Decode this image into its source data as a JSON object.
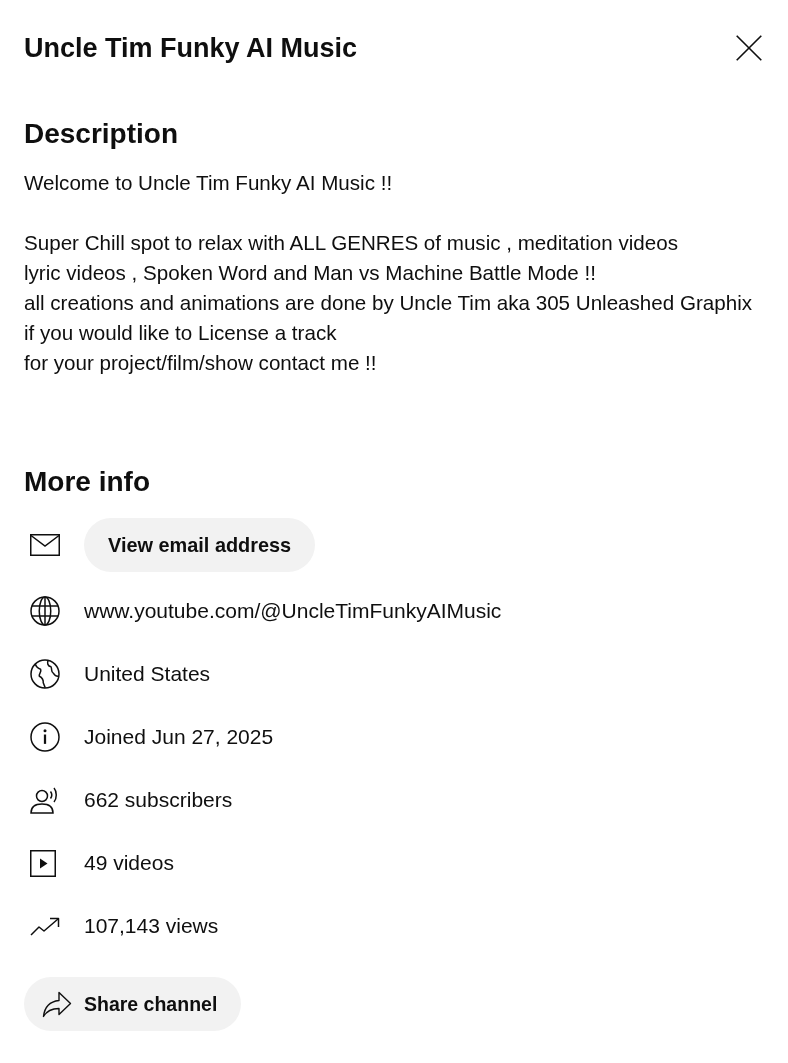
{
  "title": "Uncle Tim Funky AI Music",
  "description": {
    "heading": "Description",
    "text": "Welcome to Uncle Tim Funky AI Music !!\n\nSuper Chill spot to relax with ALL GENRES of music , meditation videos\nlyric videos , Spoken Word and Man vs Machine Battle Mode !!\nall creations and animations are done by Uncle Tim aka 305 Unleashed Graphix\nif you would like to License a track\nfor your project/film/show contact me !!"
  },
  "more_info": {
    "heading": "More info",
    "items": [
      {
        "kind": "email",
        "label": "View email address"
      },
      {
        "kind": "link",
        "label": "www.youtube.com/@UncleTimFunkyAIMusic"
      },
      {
        "kind": "country",
        "label": "United States"
      },
      {
        "kind": "joined",
        "label": "Joined Jun 27, 2025"
      },
      {
        "kind": "subscribers",
        "label": "662 subscribers"
      },
      {
        "kind": "videos",
        "label": "49 videos"
      },
      {
        "kind": "views",
        "label": "107,143 views"
      }
    ]
  },
  "share_button": {
    "label": "Share channel"
  }
}
